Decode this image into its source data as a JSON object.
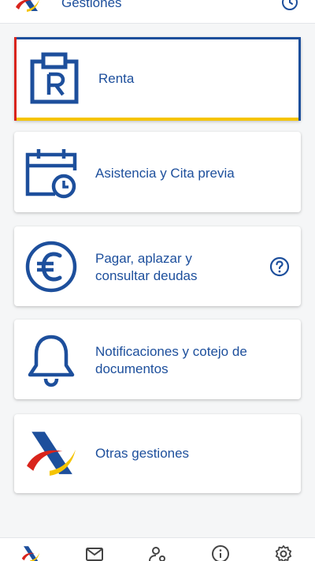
{
  "header": {
    "title": "Gestiones",
    "logo": "aeat-logo",
    "history_icon": "history-icon"
  },
  "cards": [
    {
      "label": "Renta",
      "icon": "renta-icon"
    },
    {
      "label": "Asistencia y Cita previa",
      "icon": "calendar-clock-icon"
    },
    {
      "label_line1": "Pagar, aplazar y",
      "label_line2": "consultar deudas",
      "icon": "euro-icon",
      "help_icon": "help-icon"
    },
    {
      "label_line1": "Notificaciones y cotejo de",
      "label_line2": "documentos",
      "icon": "bell-icon"
    },
    {
      "label": "Otras gestiones",
      "icon": "aeat-logo"
    }
  ],
  "bottom_nav": [
    "aeat-logo",
    "mail-icon",
    "user-settings-icon",
    "info-icon",
    "settings-icon"
  ],
  "colors": {
    "primary": "#1d4f9c",
    "red": "#d9241c",
    "yellow": "#f5c400",
    "background": "#f5f6f7"
  }
}
